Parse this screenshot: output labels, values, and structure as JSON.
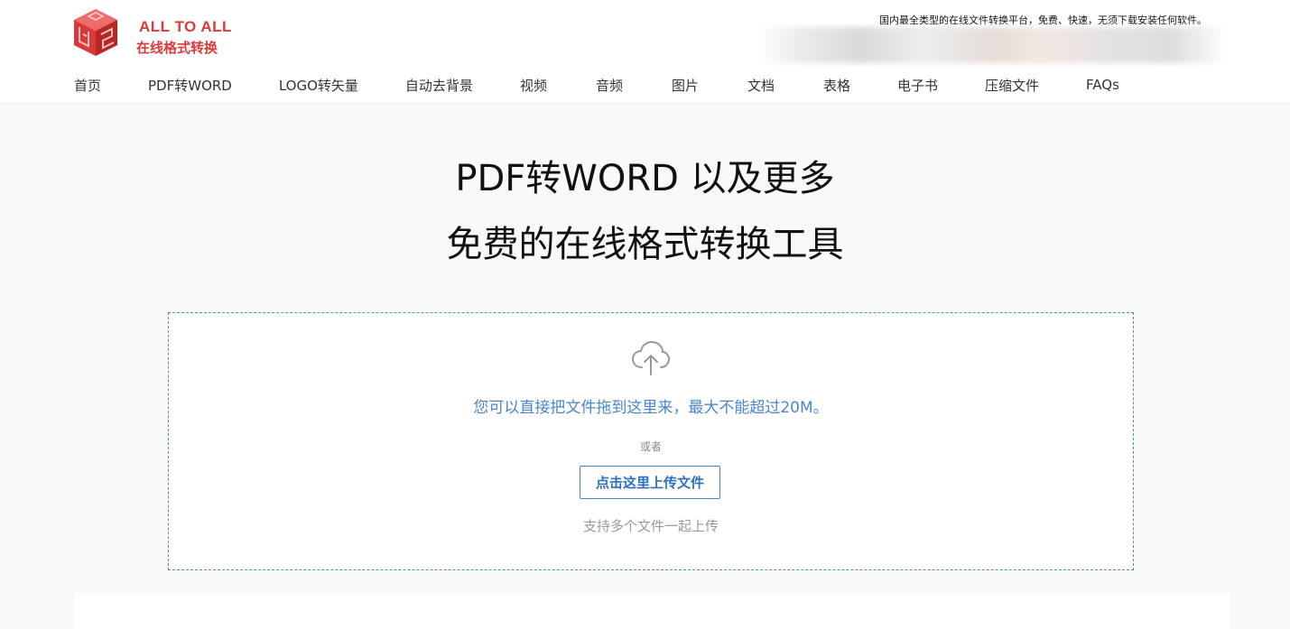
{
  "brand": {
    "name_en": "ALL TO ALL",
    "name_cn": "在线格式转换"
  },
  "header": {
    "tagline": "国内最全类型的在线文件转换平台，免费、快速，无须下载安装任何软件。"
  },
  "nav": {
    "items": [
      {
        "label": "首页"
      },
      {
        "label": "PDF转WORD"
      },
      {
        "label": "LOGO转矢量"
      },
      {
        "label": "自动去背景"
      },
      {
        "label": "视频"
      },
      {
        "label": "音频"
      },
      {
        "label": "图片"
      },
      {
        "label": "文档"
      },
      {
        "label": "表格"
      },
      {
        "label": "电子书"
      },
      {
        "label": "压缩文件"
      },
      {
        "label": "FAQs"
      }
    ]
  },
  "hero": {
    "line1": "PDF转WORD 以及更多",
    "line2": "免费的在线格式转换工具"
  },
  "upload": {
    "icon": "cloud-upload-icon",
    "drop_text": "您可以直接把文件拖到这里来，最大不能超过20M。",
    "or_text": "或者",
    "button_label": "点击这里上传文件",
    "multi_text": "支持多个文件一起上传"
  },
  "colors": {
    "brand_red": "#d93a3a",
    "link_blue": "#4a86cc"
  }
}
